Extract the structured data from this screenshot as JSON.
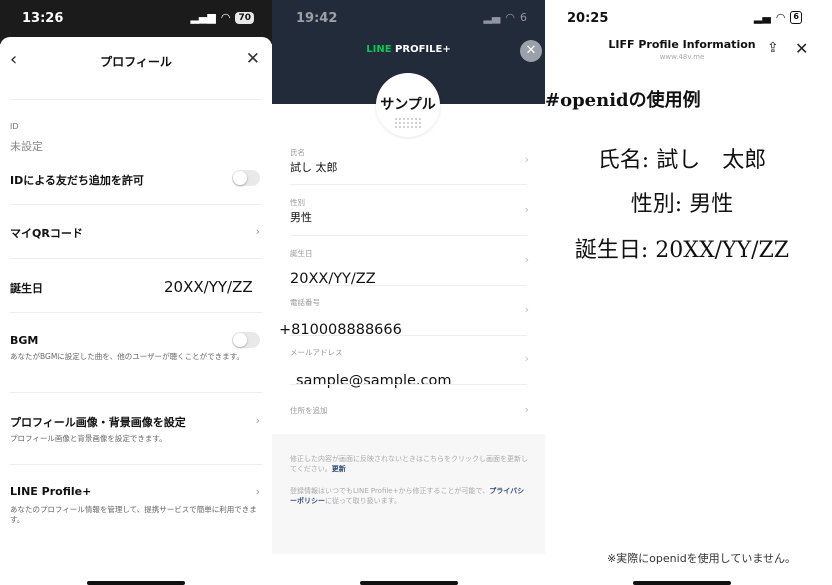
{
  "panel1": {
    "status": {
      "time": "13:26",
      "battery": "70"
    },
    "header": {
      "title": "プロフィール"
    },
    "id": {
      "label": "ID",
      "value": "未設定"
    },
    "id_friend": {
      "label": "IDによる友だち追加を許可"
    },
    "qr": {
      "label": "マイQRコード"
    },
    "birthday": {
      "label": "誕生日",
      "value": "20XX/YY/ZZ"
    },
    "bgm": {
      "label": "BGM",
      "description": "あなたがBGMに設定した曲を、他のユーザーが聴くことができます。"
    },
    "profile_image": {
      "label": "プロフィール画像・背景画像を設定",
      "description": "プロフィール画像と背景画像を設定できます。"
    },
    "line_profile_plus": {
      "label": "LINE Profile+",
      "description": "あなたのプロフィール情報を管理して、提携サービスで簡単に利用できます。"
    }
  },
  "panel2": {
    "status": {
      "time": "19:42",
      "battery": "6"
    },
    "brand": {
      "line": "LINE",
      "rest": " PROFILE+"
    },
    "avatar_name": "サンプル",
    "fields": [
      {
        "label": "氏名",
        "value": "試し 太郎"
      },
      {
        "label": "性別",
        "value": "男性"
      },
      {
        "label": "誕生日",
        "value": "20XX/YY/ZZ"
      },
      {
        "label": "電話番号",
        "value": "+810008888666"
      },
      {
        "label": "メールアドレス",
        "value": "sample@sample.com"
      },
      {
        "label": "住所を追加",
        "value": ""
      }
    ],
    "footer": {
      "text1": "修正した内容が画面に反映されないときはこちらをクリックし画面を更新してください。",
      "link1": "更新",
      "text2": "登録情報はいつでもLINE Profile+から修正することが可能で、",
      "link2": "プライバシーポリシー",
      "text3": "に従って取り扱います。"
    }
  },
  "panel3": {
    "status": {
      "time": "20:25",
      "battery": "6"
    },
    "header": {
      "title": "LIFF Profile Information",
      "subtitle": "www.48v.me"
    },
    "heading": "#openidの使用例",
    "lines": [
      "氏名: 試し　太郎",
      "性別: 男性",
      "誕生日: 20XX/YY/ZZ"
    ],
    "note": "※実際にopenidを使用していません。"
  }
}
